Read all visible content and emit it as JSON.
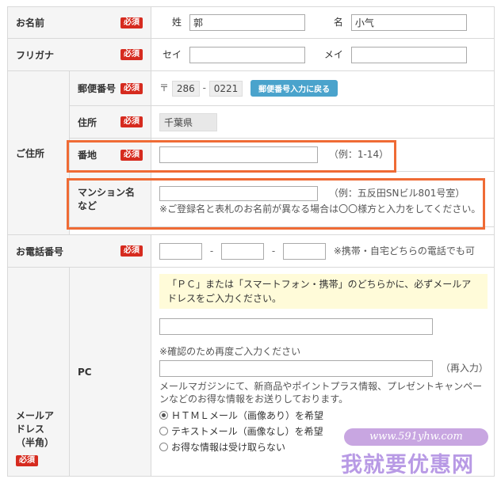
{
  "required_badge": "必須",
  "name": {
    "label": "お名前",
    "sei_label": "姓",
    "sei_value": "郭",
    "mei_label": "名",
    "mei_value": "小气"
  },
  "furigana": {
    "label": "フリガナ",
    "sei_label": "セイ",
    "sei_value": "",
    "mei_label": "メイ",
    "mei_value": ""
  },
  "address": {
    "label": "ご住所",
    "postal": {
      "label": "郵便番号",
      "prefix": "〒",
      "part1": "286",
      "dash": "-",
      "part2": "0221",
      "button": "郵便番号入力に戻る"
    },
    "jusho": {
      "label": "住所",
      "value": "千葉県"
    },
    "banchi": {
      "label": "番地",
      "value": "",
      "example": "（例：1-14）"
    },
    "mansion": {
      "label": "マンション名など",
      "value": "",
      "example": "（例：五反田SNビル801号室）",
      "note": "※ご登録名と表札のお名前が異なる場合は〇〇様方と入力をしてください。"
    }
  },
  "phone": {
    "label": "お電話番号",
    "dash": "-",
    "note": "※携帯・自宅どちらの電話でも可"
  },
  "email": {
    "label": "メールアドレス（半角）",
    "pc_label": "PC",
    "notice": "「ＰＣ」または「スマートフォン・携帯」のどちらかに、必ずメールアドレスをご入力ください。",
    "confirm_note": "※確認のため再度ご入力ください",
    "reenter": "（再入力）",
    "magazine_note": "メールマガジンにて、新商品やポイントプラス情報、プレゼントキャンペーンなどのお得な情報をお送りしております。",
    "options": [
      "ＨＴＭＬメール（画像あり）を希望",
      "テキストメール（画像なし）を希望",
      "お得な情報は受け取らない"
    ],
    "selected": 0
  },
  "watermark": {
    "url": "www.591yhw.com",
    "text": "我就要优惠网"
  },
  "colors": {
    "required": "#d62b1f",
    "highlight": "#ef6b35",
    "button": "#4aa3cc",
    "notice_bg": "#fffbd9"
  }
}
